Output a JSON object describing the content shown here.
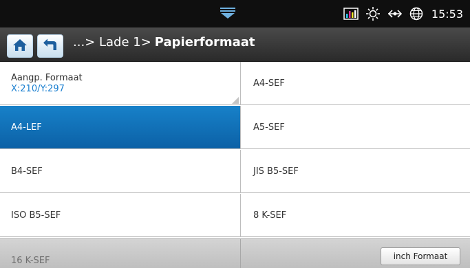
{
  "status_bar": {
    "time": "15:53",
    "icons": [
      "pull-down-handle-icon",
      "color-meter-icon",
      "toner-saver-icon",
      "network-icon",
      "globe-icon"
    ]
  },
  "header": {
    "breadcrumb_prefix": "...> Lade 1>",
    "title": "Papierformaat",
    "icons": [
      "home-icon",
      "back-icon"
    ]
  },
  "paper_sizes": {
    "custom": {
      "label": "Aangp. Formaat",
      "value": "X:210/Y:297"
    },
    "items": [
      "A4-SEF",
      "A4-LEF",
      "A5-SEF",
      "B4-SEF",
      "JIS B5-SEF",
      "ISO B5-SEF",
      "8 K-SEF",
      "16 K-SEF"
    ],
    "selected": "A4-LEF"
  },
  "footer": {
    "inch_button_label": "inch Formaat"
  },
  "colors": {
    "selected": "#0f6fb8",
    "accent_text": "#1a7fd0",
    "title_bar": "#3a3a3a"
  }
}
